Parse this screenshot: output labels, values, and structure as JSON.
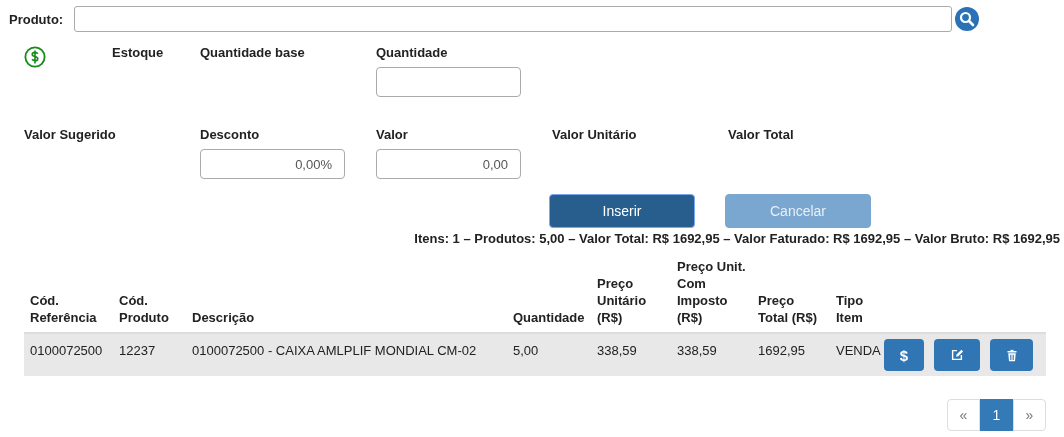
{
  "product": {
    "label": "Produto:"
  },
  "fields_row_1": [
    {
      "kind": "icon"
    },
    {
      "kind": "label",
      "label": "Estoque"
    },
    {
      "kind": "label",
      "label": "Quantidade base"
    },
    {
      "kind": "input",
      "label": "Quantidade"
    }
  ],
  "fields_row_2": [
    {
      "kind": "label",
      "label": "Valor Sugerido"
    },
    {
      "kind": "input",
      "label": "Desconto",
      "value": "0,00%"
    },
    {
      "kind": "input",
      "label": "Valor",
      "value": "0,00"
    },
    {
      "kind": "label",
      "label": "Valor Unitário"
    },
    {
      "kind": "label",
      "label": "Valor Total"
    }
  ],
  "buttons": [
    {
      "label": "Inserir",
      "disabled": false
    },
    {
      "label": "Cancelar",
      "disabled": true
    }
  ],
  "summary": "Itens: 1 – Produtos: 5,00 – Valor Total: R$ 1692,95 – Valor Faturado: R$ 1692,95 – Valor Bruto: R$ 1692,95",
  "table": {
    "columns": [
      "Cód.\nReferência",
      "Cód.\nProduto",
      "Descrição",
      "Quantidade",
      "Preço\nUnitário\n(R$)",
      "Preço Unit.\nCom\nImposto\n(R$)",
      "Preço\nTotal (R$)",
      "Tipo\nItem"
    ],
    "rows": [
      {
        "cells": [
          "0100072500",
          "12237",
          "0100072500 - CAIXA AMLPLIF MONDIAL CM-02",
          "5,00",
          "338,59",
          "338,59",
          "1692,95",
          "VENDA"
        ],
        "actions": [
          {
            "kind": "price",
            "label": "$"
          },
          {
            "kind": "edit"
          },
          {
            "kind": "delete"
          }
        ]
      }
    ]
  },
  "pagination": [
    {
      "label": "«",
      "selected": false
    },
    {
      "label": "1",
      "selected": true
    },
    {
      "label": "»",
      "selected": false
    }
  ]
}
